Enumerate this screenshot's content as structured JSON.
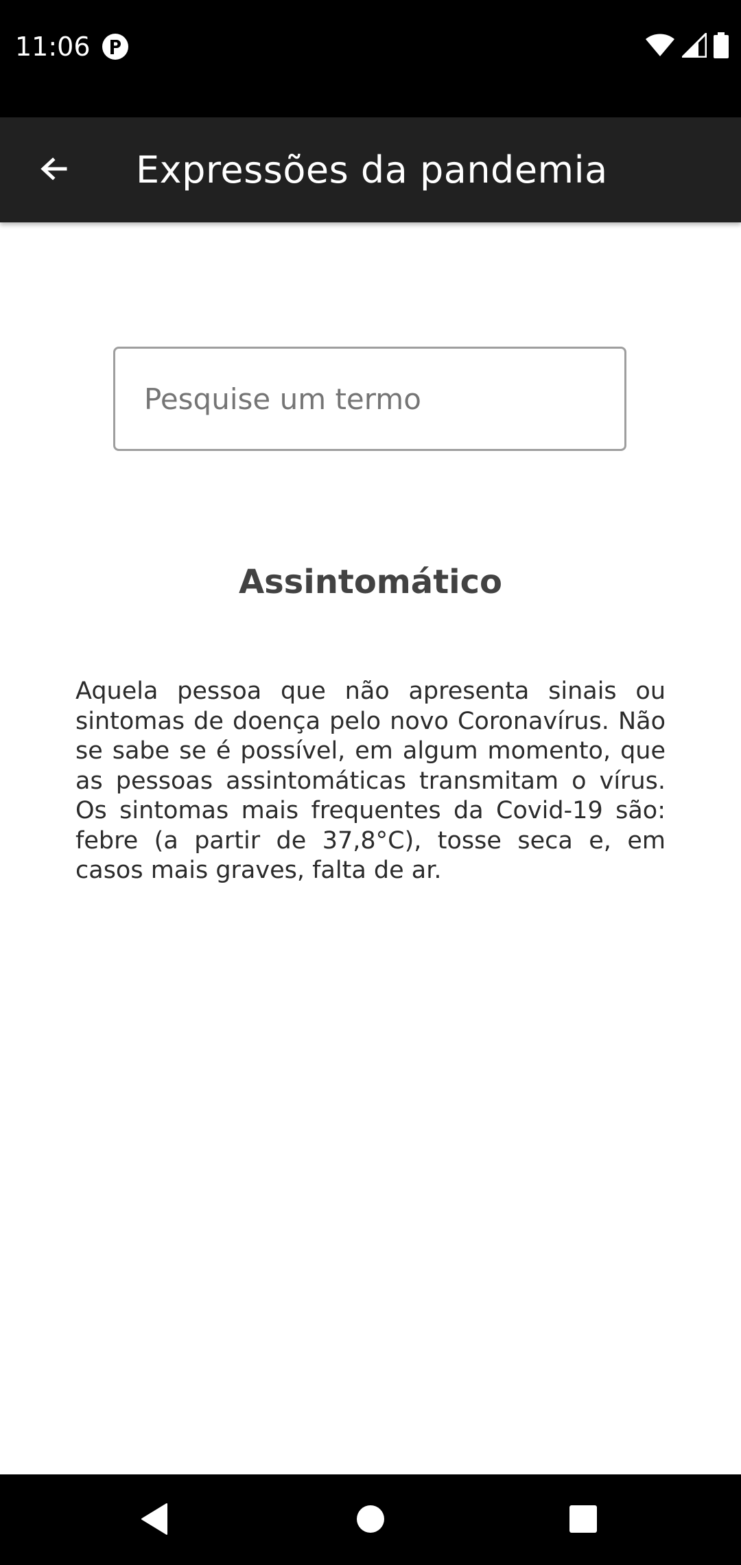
{
  "status_bar": {
    "time": "11:06",
    "app_icon": "circle-p-icon",
    "icons": [
      "wifi-icon",
      "signal-icon",
      "battery-icon"
    ]
  },
  "app_bar": {
    "back_icon": "arrow-left-icon",
    "title": "Expressões da pandemia"
  },
  "search": {
    "value": "",
    "placeholder": "Pesquise um termo"
  },
  "term": {
    "title": "Assintomático",
    "description": "Aquela pessoa que não apresenta sinais ou sintomas de doença pelo novo Coronavírus. Não se sabe se é possível, em algum momento, que as pessoas assintomáticas transmitam o vírus. Os sintomas mais frequentes da Covid-19 são: febre (a partir de 37,8°C), tosse seca e, em casos mais graves, falta de ar."
  },
  "nav_bar": {
    "buttons": [
      "back-triangle-icon",
      "home-circle-icon",
      "recents-square-icon"
    ]
  },
  "colors": {
    "status_bar": "#000000",
    "app_bar": "#212121",
    "background": "#ffffff",
    "title_text": "#424242",
    "body_text": "#2b2b2b",
    "input_border": "#9e9e9e"
  }
}
